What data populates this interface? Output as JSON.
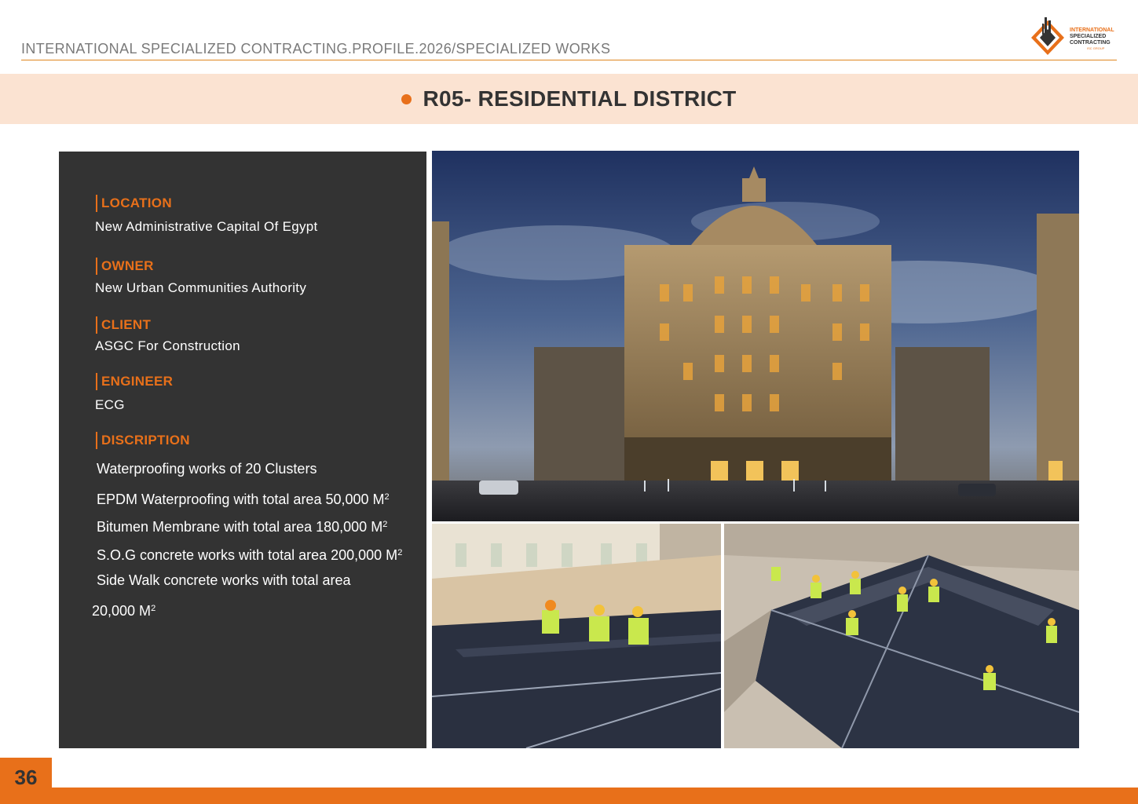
{
  "header": {
    "path": "INTERNATIONAL SPECIALIZED CONTRACTING.PROFILE.2026/SPECIALIZED WORKS",
    "logo": {
      "line1": "INTERNATIONAL",
      "line2": "SPECIALIZED",
      "line3": "CONTRACTING",
      "line4": "ISC GROUP",
      "accent": "#e8701a"
    }
  },
  "title": "R05- RESIDENTIAL DISTRICT",
  "info": {
    "location_label": "LOCATION",
    "location_value": "New Administrative Capital Of Egypt",
    "owner_label": "OWNER",
    "owner_value": "New Urban Communities Authority",
    "client_label": "CLIENT",
    "client_value": "ASGC For Construction",
    "engineer_label": "ENGINEER",
    "engineer_value": "ECG",
    "description_label": "DISCRIPTION",
    "description_lines": [
      "Waterproofing works of 20 Clusters",
      "EPDM Waterproofing with total area 50,000 M",
      "Bitumen Membrane  with total area 180,000 M",
      "S.O.G concrete works with total area 200,000 M",
      "Side Walk concrete works with total area",
      "20,000 M"
    ],
    "superscript": "2"
  },
  "page_number": "36",
  "colors": {
    "accent": "#e8701a",
    "panel": "#333333",
    "band": "#fbe3d2"
  }
}
